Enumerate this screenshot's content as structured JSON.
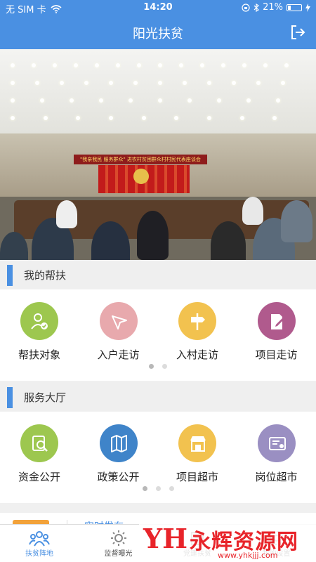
{
  "status_bar": {
    "carrier": "无 SIM 卡",
    "time": "14:20",
    "battery_percent": "21%",
    "battery_level": 0.21,
    "icons": [
      "wifi-icon",
      "orientation-lock-icon",
      "bluetooth-icon",
      "charging-icon"
    ]
  },
  "nav": {
    "title": "阳光扶贫",
    "logout_icon": "logout-icon"
  },
  "banner": {
    "caption": "\"我亲我民 服务群众\" 进农村贫困群众村村民代表座谈会",
    "slide_count": 5,
    "active_slide": 1
  },
  "my_help": {
    "title": "我的帮扶",
    "items": [
      {
        "label": "帮扶对象",
        "icon": "person-check-icon",
        "color": "#9dc74f"
      },
      {
        "label": "入户走访",
        "icon": "navigation-arrow-icon",
        "color": "#e8a9ad"
      },
      {
        "label": "入村走访",
        "icon": "signpost-icon",
        "color": "#f2c24f"
      },
      {
        "label": "项目走访",
        "icon": "document-edit-icon",
        "color": "#b05a8d"
      }
    ],
    "pages": 2,
    "active_page": 1
  },
  "service_hall": {
    "title": "服务大厅",
    "items": [
      {
        "label": "资金公开",
        "icon": "money-search-icon",
        "color": "#9dc74f"
      },
      {
        "label": "政策公开",
        "icon": "map-book-icon",
        "color": "#3f84c9"
      },
      {
        "label": "项目超市",
        "icon": "storefront-icon",
        "color": "#f2c24f"
      },
      {
        "label": "岗位超市",
        "icon": "certificate-icon",
        "color": "#9a8fc2"
      }
    ],
    "pages": 3,
    "active_page": 1
  },
  "news": {
    "headline": "实时发布"
  },
  "tabs": [
    {
      "label": "扶贫阵地",
      "icon": "group-icon",
      "active": true
    },
    {
      "label": "监督曝光",
      "icon": "sun-icon",
      "active": false
    },
    {
      "label": "党建扶贫",
      "icon": "party-icon",
      "active": false
    },
    {
      "label": "我的设置",
      "icon": "settings-icon",
      "active": false
    }
  ],
  "watermark": {
    "logo": "YH",
    "text": "永辉资源网",
    "url": "www.yhkjjj.com"
  }
}
